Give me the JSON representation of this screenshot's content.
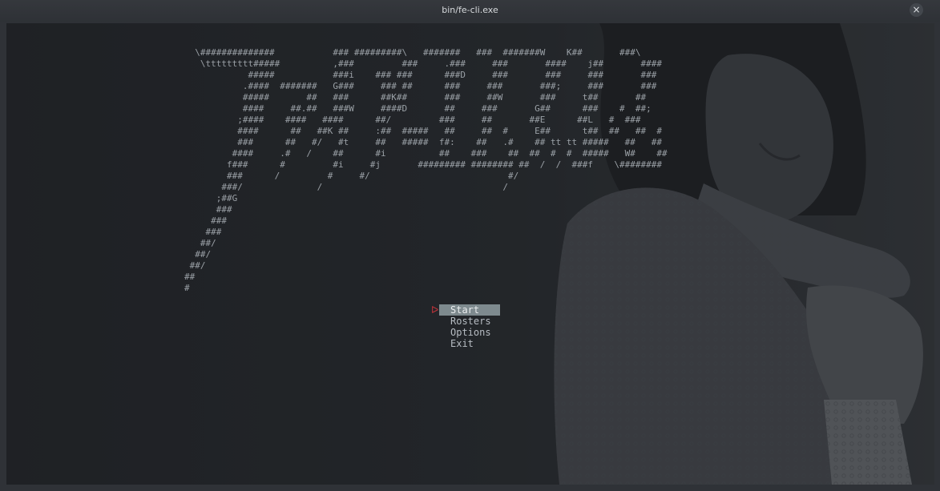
{
  "window": {
    "title": "bin/fe-cli.exe",
    "close_icon": "×"
  },
  "colors": {
    "terminal_bg": "#1f2125",
    "banner_text": "#9aa0a6",
    "menu_text": "#b6bcc2",
    "selected_bg": "#7e8a8e",
    "cursor": "#c7333a"
  },
  "banner_ascii": "  \\##############           ### #########\\   #######   ###  #######W    K##       ###\\\n   \\ttttttttt#####          ,###         ###     .###     ###       ####    j##       ####\n            #####           ###i    ### ###      ###D     ###       ###     ###       ###\n           .####  #######   G###     ### ##      ###     ###       ###;     ###       ###\n           #####       ##   ###      ##K##       ###     ##W       ###     t##       ##\n           ####     ##.##   ###W     ####D       ##     ###       G##      ###    #  ##;\n          ;####    ####   ####      ##/         ###     ##       ##E      ##L   #  ###\n          ####      ##   ##K ##     :##  #####   ##     ##  #     E##      t##  ##   ##  #\n          ###      ##   #/   #t     ##   #####  f#:    ##   .#    ## tt tt #####   ##   ##\n         ####     .#   /    ##      #i          ##    ###    ##  ##  #  #  #####   W#    ##\n        f###      #         #i     #j       ######### ######## ##  /  /  ###f    \\########\n        ###      /         #     #/                          #/\n       ###/              /                                  /\n      ;##G\n      ###\n     ###\n    ###\n   ##/\n  ##/\n ##/\n##\n#",
  "menu": {
    "cursor_symbol": "ᐅ",
    "items": [
      "Start",
      "Rosters",
      "Options",
      "Exit"
    ],
    "selected_index": 0
  }
}
